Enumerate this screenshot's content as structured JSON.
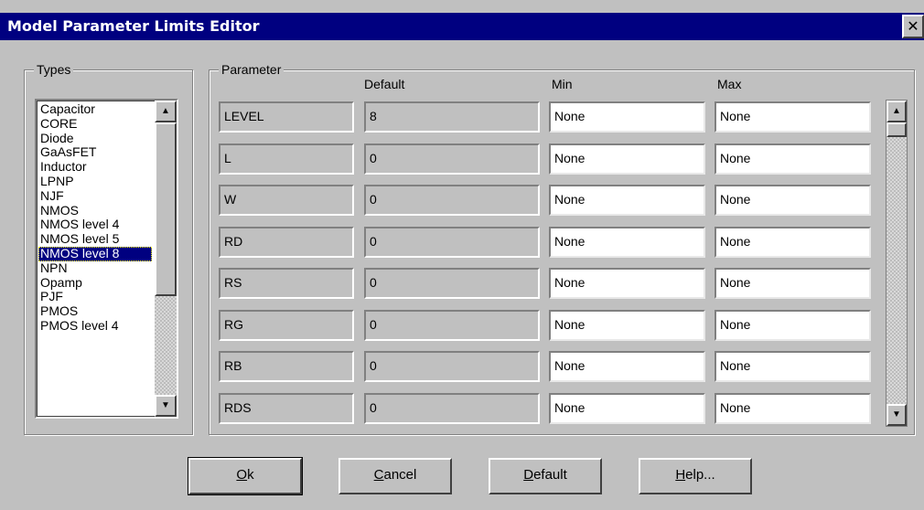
{
  "window": {
    "title": "Model Parameter Limits Editor",
    "close_glyph": "✕"
  },
  "types": {
    "label": "Types",
    "items": [
      "Capacitor",
      "CORE",
      "Diode",
      "GaAsFET",
      "Inductor",
      "LPNP",
      "NJF",
      "NMOS",
      "NMOS level 4",
      "NMOS level 5",
      "NMOS level 8",
      "NPN",
      "Opamp",
      "PJF",
      "PMOS",
      "PMOS level 4"
    ],
    "selected": "NMOS level 8"
  },
  "parameters": {
    "label": "Parameter",
    "headers": {
      "default": "Default",
      "min": "Min",
      "max": "Max"
    },
    "rows": [
      {
        "name": "LEVEL",
        "default": "8",
        "min": "None",
        "max": "None"
      },
      {
        "name": "L",
        "default": "0",
        "min": "None",
        "max": "None"
      },
      {
        "name": "W",
        "default": "0",
        "min": "None",
        "max": "None"
      },
      {
        "name": "RD",
        "default": "0",
        "min": "None",
        "max": "None"
      },
      {
        "name": "RS",
        "default": "0",
        "min": "None",
        "max": "None"
      },
      {
        "name": "RG",
        "default": "0",
        "min": "None",
        "max": "None"
      },
      {
        "name": "RB",
        "default": "0",
        "min": "None",
        "max": "None"
      },
      {
        "name": "RDS",
        "default": "0",
        "min": "None",
        "max": "None"
      }
    ]
  },
  "scroll_icons": {
    "up": "▲",
    "down": "▼"
  },
  "buttons": {
    "ok": {
      "accel": "O",
      "rest": "k"
    },
    "cancel": {
      "accel": "C",
      "rest": "ancel"
    },
    "default": {
      "accel": "D",
      "rest": "efault"
    },
    "help": {
      "accel": "H",
      "rest": "elp..."
    }
  }
}
